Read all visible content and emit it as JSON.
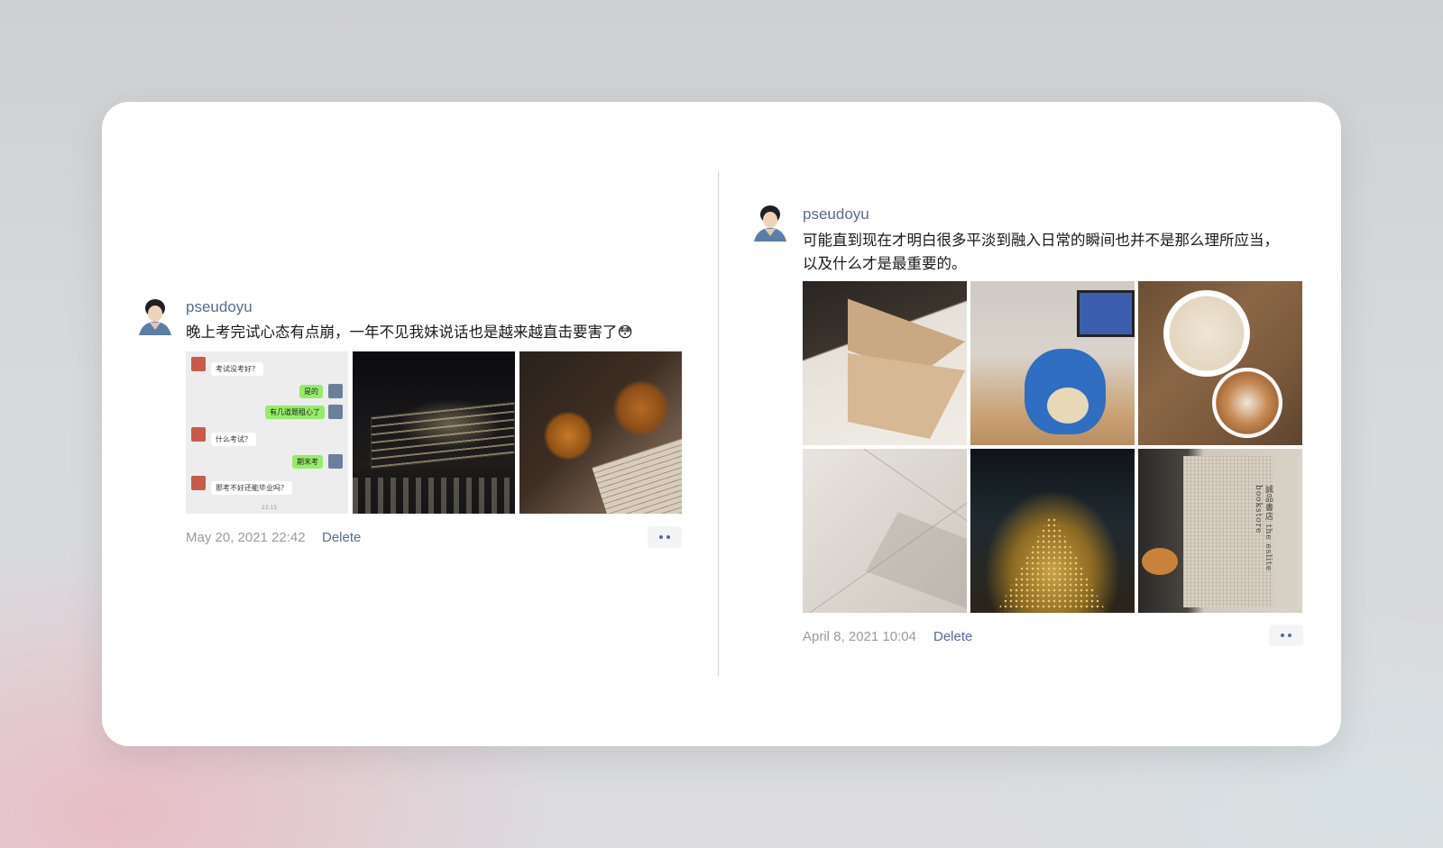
{
  "colors": {
    "link": "#576b95",
    "meta": "#9b9b9b",
    "text": "#1a1a1a"
  },
  "posts": [
    {
      "username": "pseudoyu",
      "text": "晚上考完试心态有点崩，一年不见我妹说话也是越来越直击要害了😳",
      "time": "May 20, 2021 22:42",
      "delete_label": "Delete",
      "chat": {
        "messages": [
          "考试没考好？",
          "是的",
          "有几道题租心了",
          "什么考试？",
          "期末考",
          "那考不好还能毕业吗？"
        ],
        "time": "22:15"
      },
      "photos": [
        "chat-screenshot",
        "bar-menu-photo",
        "fries-and-beer-photo"
      ]
    },
    {
      "username": "pseudoyu",
      "text_line1": "可能直到现在才明白很多平淡到融入日常的瞬间也并不是那么理所应当，",
      "text_line2": "以及什么才是最重要的。",
      "time": "April 8, 2021 10:04",
      "delete_label": "Delete",
      "book_text": "誠品書店 the eslite bookstore",
      "photos": [
        "toast-photo",
        "plush-toy-photo",
        "coffee-photo",
        "tile-floor-photo",
        "golden-tree-photo",
        "bookstore-bag-photo"
      ]
    }
  ]
}
